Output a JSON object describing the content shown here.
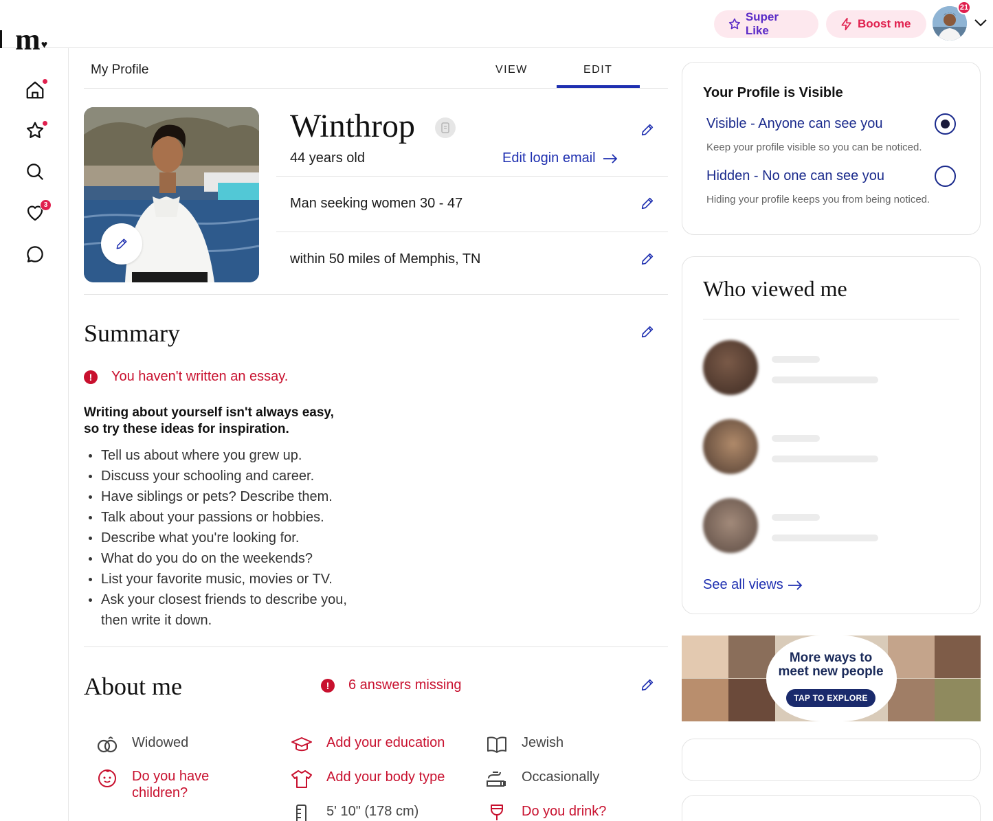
{
  "brand": {
    "logo_text": "m."
  },
  "header": {
    "super_like_label": "Super Like",
    "boost_label": "Boost me",
    "notification_count": "21",
    "colors": {
      "super_like": "#5b2bc7",
      "boost": "#e0204e",
      "pill_bg": "#fde8ee"
    }
  },
  "nav": {
    "items": [
      {
        "icon": "home-icon",
        "has_dot": true
      },
      {
        "icon": "star-icon",
        "has_dot": true
      },
      {
        "icon": "search-icon",
        "has_dot": false
      },
      {
        "icon": "heart-icon",
        "badge": "3"
      },
      {
        "icon": "chat-icon",
        "has_dot": false
      }
    ]
  },
  "page": {
    "title": "My Profile",
    "tabs": [
      {
        "label": "VIEW"
      },
      {
        "label": "EDIT",
        "active": true
      }
    ]
  },
  "profile": {
    "name": "Winthrop",
    "age_text": "44 years old",
    "edit_login_email": "Edit login email",
    "seeking": "Man seeking women 30 - 47",
    "location": "within 50 miles of Memphis, TN"
  },
  "summary": {
    "title": "Summary",
    "alert": "You haven't written an essay.",
    "prompt_line1": "Writing about yourself isn't always easy,",
    "prompt_line2": "so try these ideas for inspiration.",
    "ideas": [
      "Tell us about where you grew up.",
      "Discuss your schooling and career.",
      "Have siblings or pets? Describe them.",
      "Talk about your passions or hobbies.",
      "Describe what you're looking for.",
      "What do you do on the weekends?",
      "List your favorite music, movies or TV.",
      "Ask your closest friends to describe you, then write it down."
    ]
  },
  "about": {
    "title": "About me",
    "missing_alert": "6 answers missing",
    "items": [
      {
        "label": "Widowed",
        "icon": "rings-icon",
        "missing": false
      },
      {
        "label": "Add your education",
        "icon": "graduation-cap-icon",
        "missing": true
      },
      {
        "label": "Jewish",
        "icon": "book-icon",
        "missing": false
      },
      {
        "label": "Do you have children?",
        "icon": "baby-icon",
        "missing": true
      },
      {
        "label": "Add your body type",
        "icon": "shirt-icon",
        "missing": true
      },
      {
        "label": "Occasionally",
        "icon": "smoking-icon",
        "missing": false
      },
      {
        "label": "5' 10\" (178 cm)",
        "icon": "ruler-icon",
        "missing": false
      },
      {
        "label": "Do you drink?",
        "icon": "wine-glass-icon",
        "missing": true
      }
    ],
    "colors": {
      "missing": "#c8102e"
    }
  },
  "visibility": {
    "title": "Your Profile is Visible",
    "visible_label": "Visible - Anyone can see you",
    "visible_sub": "Keep your profile visible so you can be noticed.",
    "hidden_label": "Hidden - No one can see you",
    "hidden_sub": "Hiding your profile keeps you from being noticed.",
    "selected": "visible"
  },
  "who_viewed": {
    "title": "Who viewed me",
    "see_all": "See all views"
  },
  "promo": {
    "headline_line1": "More ways to",
    "headline_line2": "meet new people",
    "cta": "TAP TO EXPLORE"
  },
  "colors": {
    "link": "#1e2fb0",
    "alert": "#c8102e"
  }
}
